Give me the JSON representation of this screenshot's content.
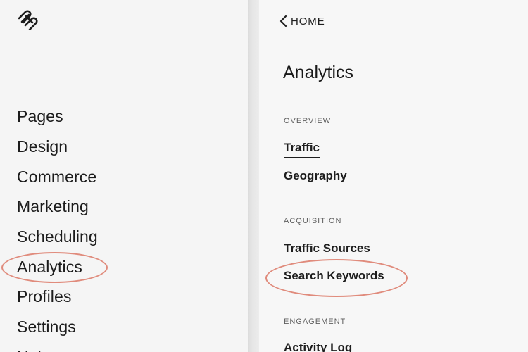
{
  "left_nav": {
    "items": [
      {
        "label": "Pages"
      },
      {
        "label": "Design"
      },
      {
        "label": "Commerce"
      },
      {
        "label": "Marketing"
      },
      {
        "label": "Scheduling"
      },
      {
        "label": "Analytics"
      },
      {
        "label": "Profiles"
      },
      {
        "label": "Settings"
      },
      {
        "label": "Help"
      }
    ]
  },
  "analytics_panel": {
    "back_label": "HOME",
    "title": "Analytics",
    "sections": [
      {
        "header": "OVERVIEW",
        "items": [
          "Traffic",
          "Geography"
        ]
      },
      {
        "header": "ACQUISITION",
        "items": [
          "Traffic Sources",
          "Search Keywords"
        ]
      },
      {
        "header": "ENGAGEMENT",
        "items": [
          "Activity Log"
        ]
      }
    ],
    "active_item": "Traffic"
  },
  "colors": {
    "annotation": "#e08b7c",
    "text": "#1e1e1e",
    "panel_bg": "#f5f5f5"
  },
  "icons": [
    "squarespace-logo-icon",
    "chevron-left-icon"
  ]
}
